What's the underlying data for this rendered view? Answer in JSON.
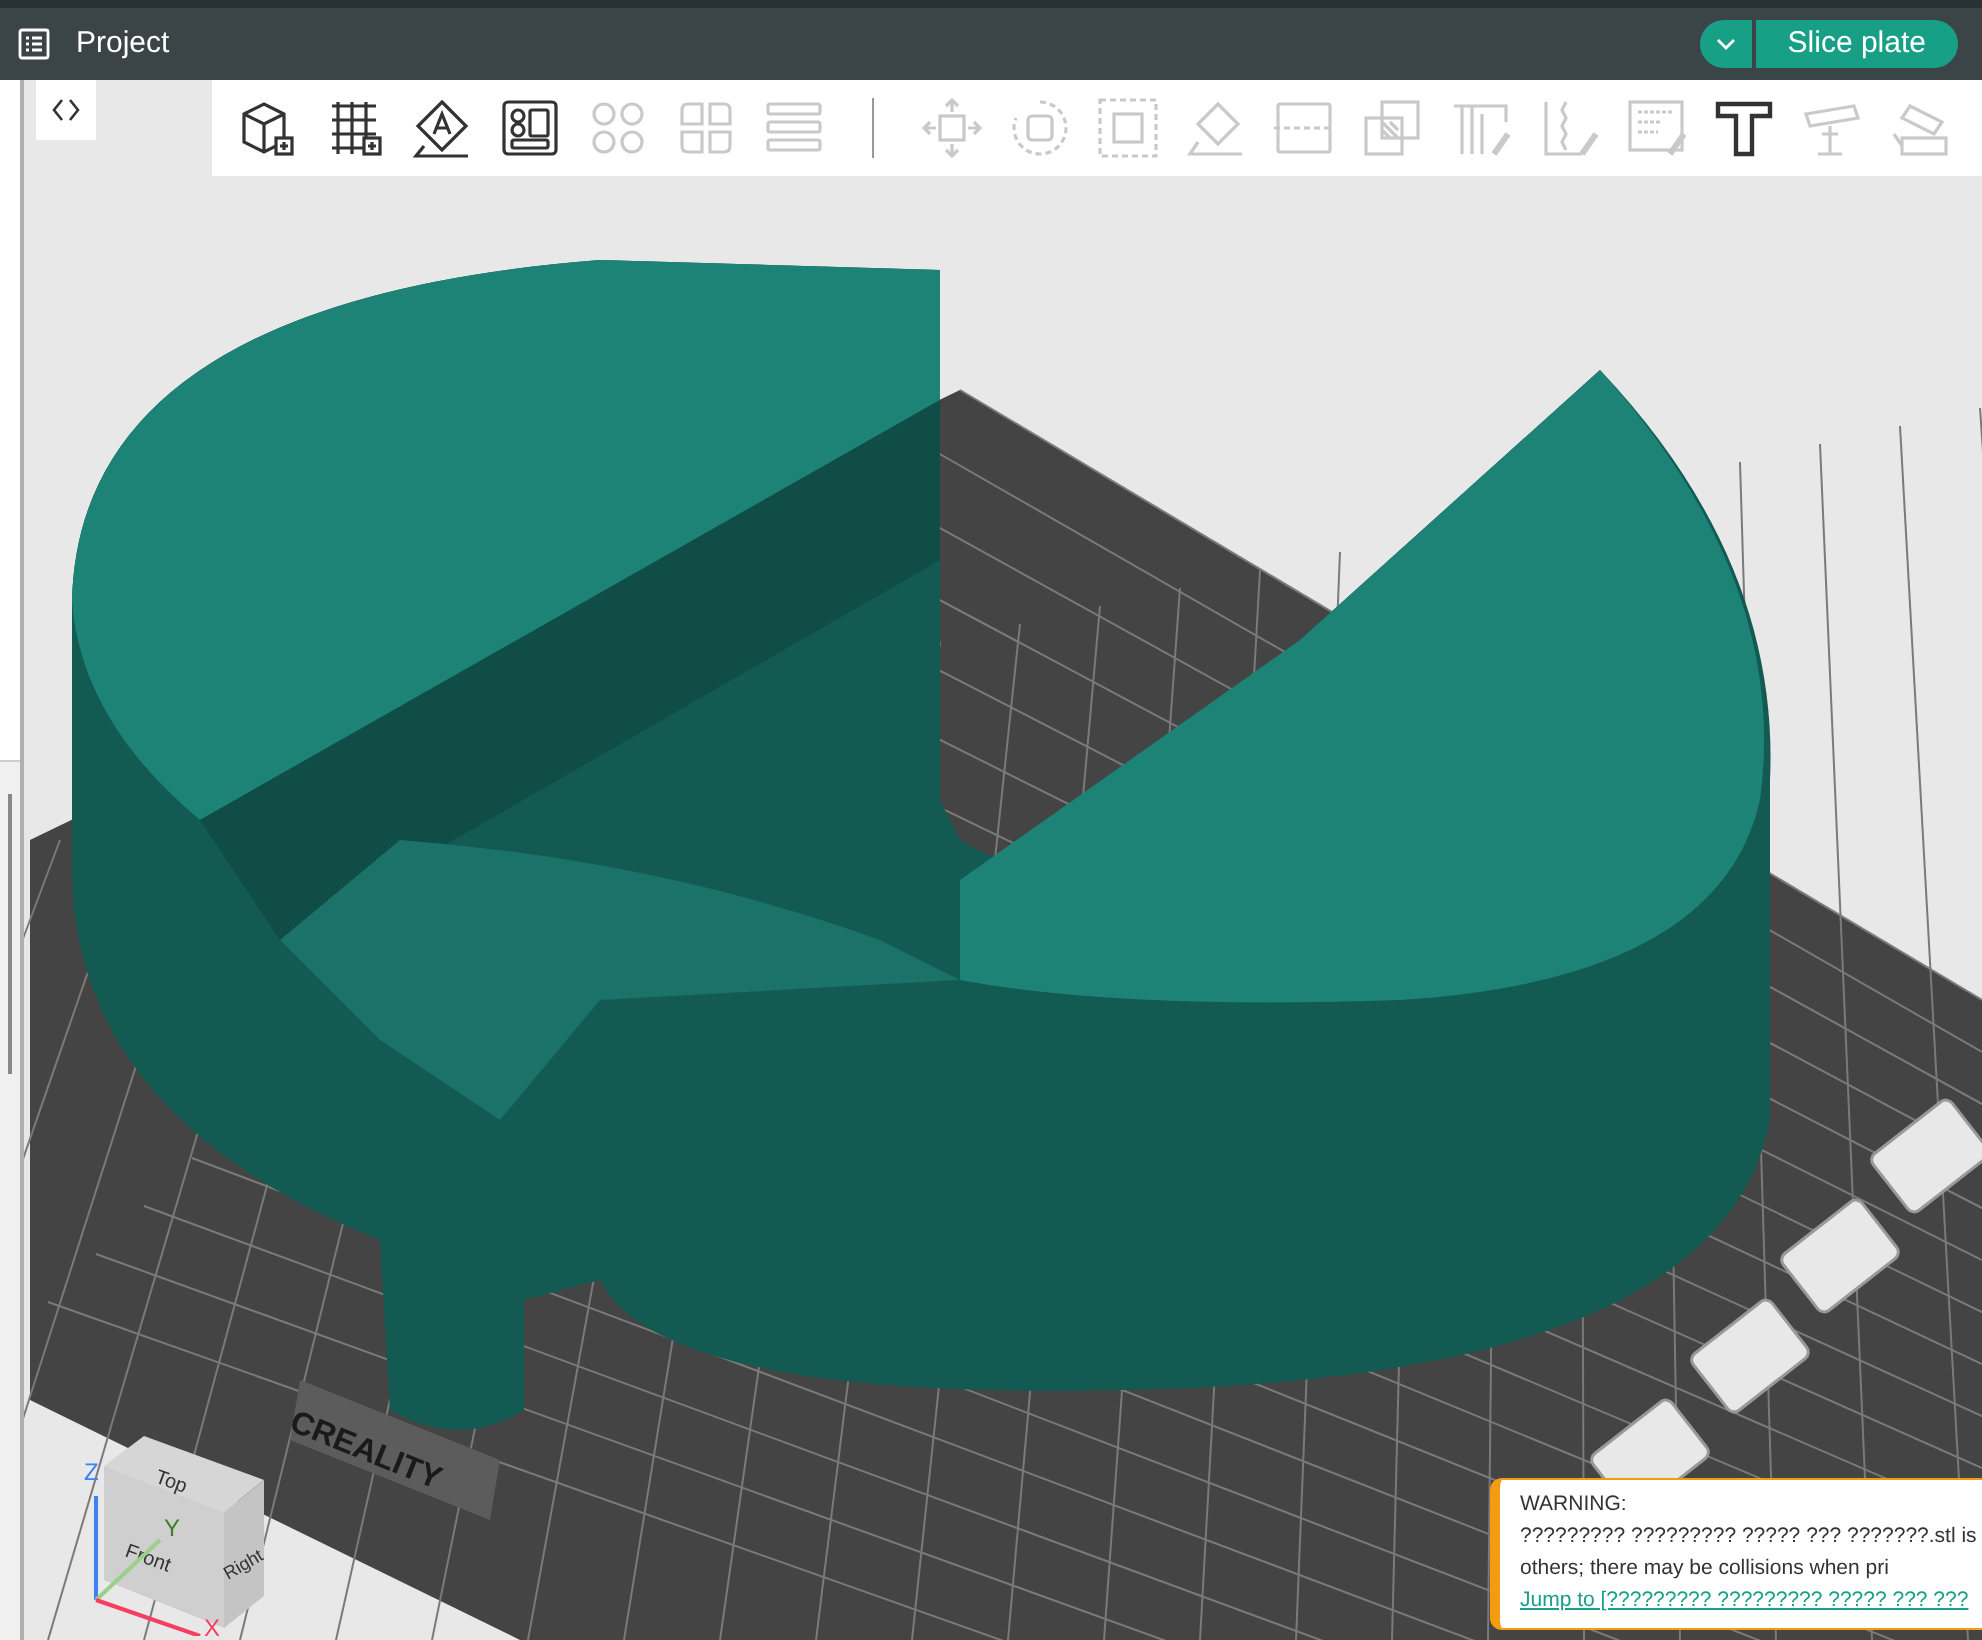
{
  "window": {
    "title": "Project"
  },
  "slice_button": {
    "label": "Slice plate"
  },
  "toolbar": [
    {
      "kind": "cube",
      "disabled": false
    },
    {
      "kind": "grid",
      "disabled": false
    },
    {
      "kind": "orient",
      "disabled": false
    },
    {
      "kind": "arrange",
      "disabled": false
    },
    {
      "kind": "split-objects",
      "disabled": true
    },
    {
      "kind": "split-parts",
      "disabled": true
    },
    {
      "kind": "lines",
      "disabled": true
    },
    {
      "kind": "separator"
    },
    {
      "kind": "move",
      "disabled": true
    },
    {
      "kind": "rotate",
      "disabled": true
    },
    {
      "kind": "scale",
      "disabled": true
    },
    {
      "kind": "lay-flat",
      "disabled": true
    },
    {
      "kind": "cut",
      "disabled": true
    },
    {
      "kind": "boolean",
      "disabled": true
    },
    {
      "kind": "paint",
      "disabled": true
    },
    {
      "kind": "seam",
      "disabled": true
    },
    {
      "kind": "fuzzy",
      "disabled": true
    },
    {
      "kind": "text",
      "disabled": false
    },
    {
      "kind": "measure",
      "disabled": true
    },
    {
      "kind": "assemble",
      "disabled": true
    }
  ],
  "bed_logo": "CREALITY",
  "view_cube": {
    "top": "Top",
    "front": "Front",
    "right": "Right",
    "x": "X",
    "y": "Y",
    "z": "Z"
  },
  "notification": {
    "title": "WARNING:",
    "lines": [
      "????????? ????????? ????? ??? ???????.stl is",
      "others; there may be collisions when pri"
    ],
    "link": "Jump to [????????? ????????? ????? ??? ???"
  }
}
